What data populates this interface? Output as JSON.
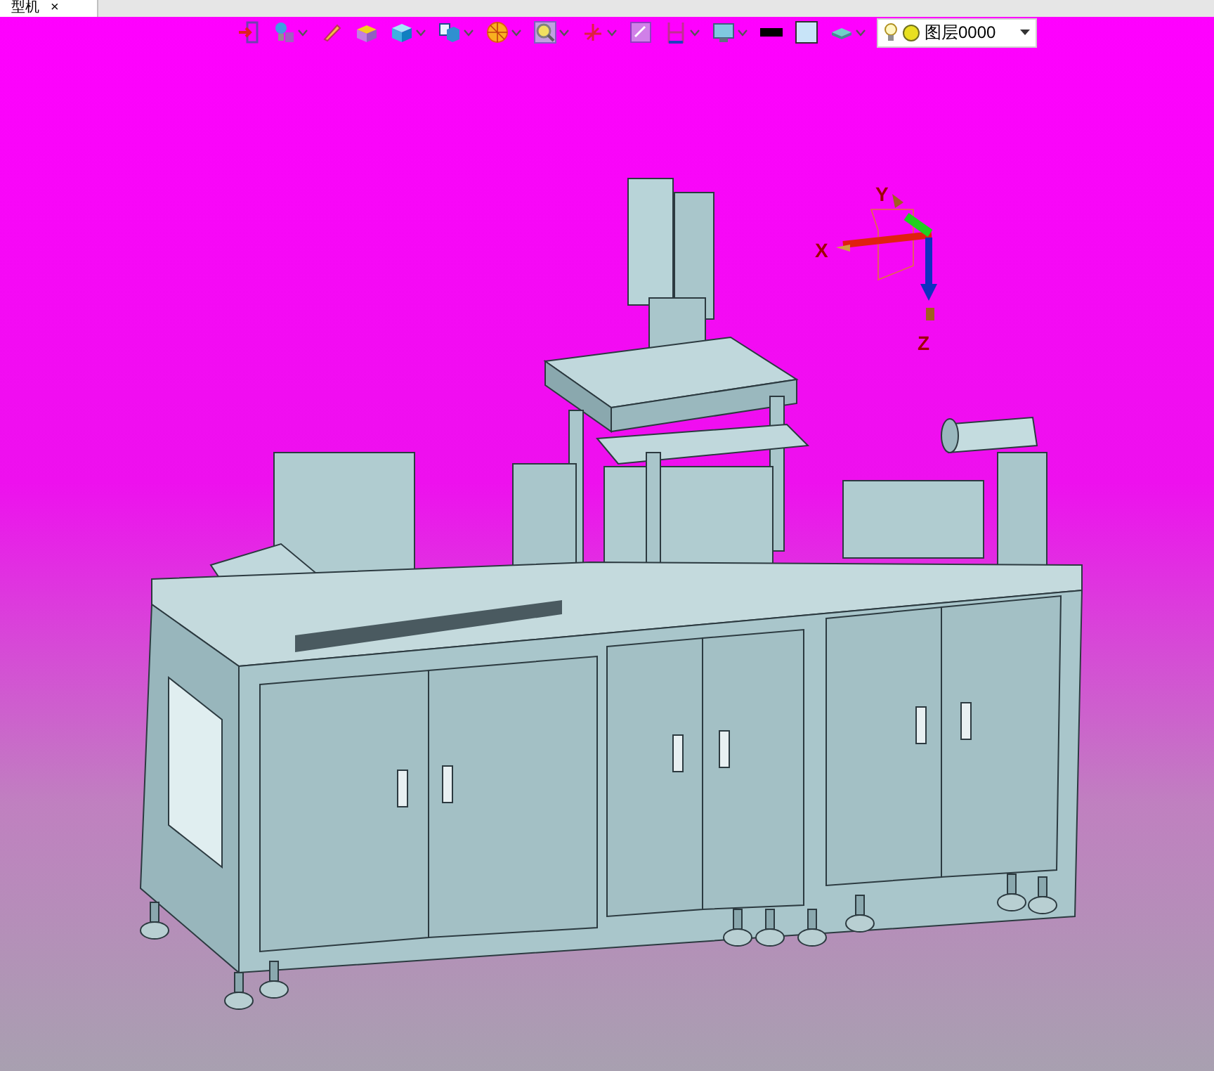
{
  "tab": {
    "title": "型机",
    "close": "×"
  },
  "toolbar": [
    {
      "kind": "exit",
      "dropdown": false
    },
    {
      "kind": "light",
      "dropdown": true
    },
    {
      "kind": "pencil",
      "dropdown": false
    },
    {
      "kind": "box-yellow",
      "dropdown": false
    },
    {
      "kind": "cube",
      "dropdown": true
    },
    {
      "kind": "views",
      "dropdown": true
    },
    {
      "kind": "shading",
      "dropdown": true
    },
    {
      "kind": "zoom",
      "dropdown": true
    },
    {
      "kind": "axis",
      "dropdown": true
    },
    {
      "kind": "fit",
      "dropdown": false
    },
    {
      "kind": "frame",
      "dropdown": true
    },
    {
      "kind": "display",
      "dropdown": true
    },
    {
      "kind": "line",
      "dropdown": false
    },
    {
      "kind": "color",
      "dropdown": false
    },
    {
      "kind": "layer",
      "dropdown": true
    }
  ],
  "layer_select": {
    "value": "图层0000"
  },
  "triad": {
    "x": "X",
    "y": "Y",
    "z": "Z"
  }
}
